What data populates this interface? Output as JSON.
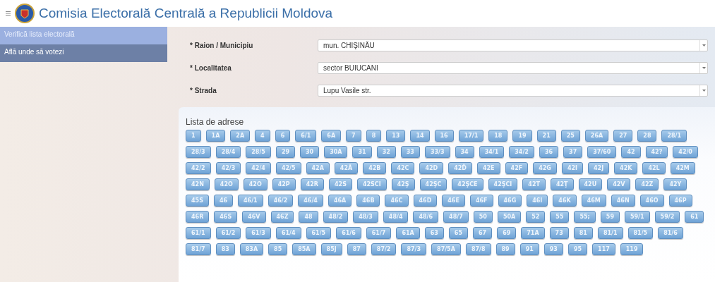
{
  "header": {
    "title": "Comisia Electorală Centrală a Republicii Moldova"
  },
  "sidebar": {
    "items": [
      {
        "label": "Verifică lista electorală",
        "selected": false
      },
      {
        "label": "Află unde să votezi",
        "selected": true
      }
    ]
  },
  "form": {
    "fields": [
      {
        "label": "* Raion / Municipiu",
        "value": "mun. CHIŞINĂU"
      },
      {
        "label": "* Localitatea",
        "value": "sector BUIUCANI"
      },
      {
        "label": "* Strada",
        "value": "Lupu Vasile str."
      }
    ]
  },
  "addresses": {
    "title": "Lista de adrese",
    "items": [
      "1",
      "1A",
      "2A",
      "4",
      "6",
      "6/1",
      "6A",
      "7",
      "8",
      "13",
      "14",
      "16",
      "17/1",
      "18",
      "19",
      "21",
      "25",
      "26A",
      "27",
      "28",
      "28/1",
      "28/3",
      "28/4",
      "28/5",
      "29",
      "30",
      "30A",
      "31",
      "32",
      "33",
      "33/3",
      "34",
      "34/1",
      "34/2",
      "36",
      "37",
      "37/60",
      "42",
      "42?",
      "42/0",
      "42/2",
      "42/3",
      "42/4",
      "42/5",
      "42A",
      "42Ă",
      "42B",
      "42C",
      "42D",
      "42Ď",
      "42E",
      "42F",
      "42G",
      "42I",
      "42J",
      "42K",
      "42L",
      "42M",
      "42N",
      "42O",
      "42O",
      "42P",
      "42R",
      "42S",
      "42SCI",
      "42Ş",
      "42ŞC",
      "42ŞCE",
      "42ŞCI",
      "42T",
      "42Ţ",
      "42U",
      "42V",
      "42Z",
      "42Y",
      "45S",
      "46",
      "46/1",
      "46/2",
      "46/4",
      "46A",
      "46B",
      "46C",
      "46D",
      "46E",
      "46F",
      "46G",
      "46I",
      "46K",
      "46M",
      "46N",
      "46O",
      "46P",
      "46R",
      "46S",
      "46V",
      "46Z",
      "48",
      "48/2",
      "48/3",
      "48/4",
      "48/6",
      "48/7",
      "50",
      "50A",
      "52",
      "55",
      "55;",
      "59",
      "59/1",
      "59/2",
      "61",
      "61/1",
      "61/2",
      "61/3",
      "61/4",
      "61/5",
      "61/6",
      "61/7",
      "61A",
      "63",
      "65",
      "67",
      "69",
      "71A",
      "73",
      "81",
      "81/1",
      "81/5",
      "81/6",
      "81/7",
      "83",
      "83A",
      "85",
      "85A",
      "85J",
      "87",
      "87/2",
      "87/3",
      "87/5A",
      "87/8",
      "89",
      "91",
      "93",
      "95",
      "117",
      "119"
    ]
  }
}
